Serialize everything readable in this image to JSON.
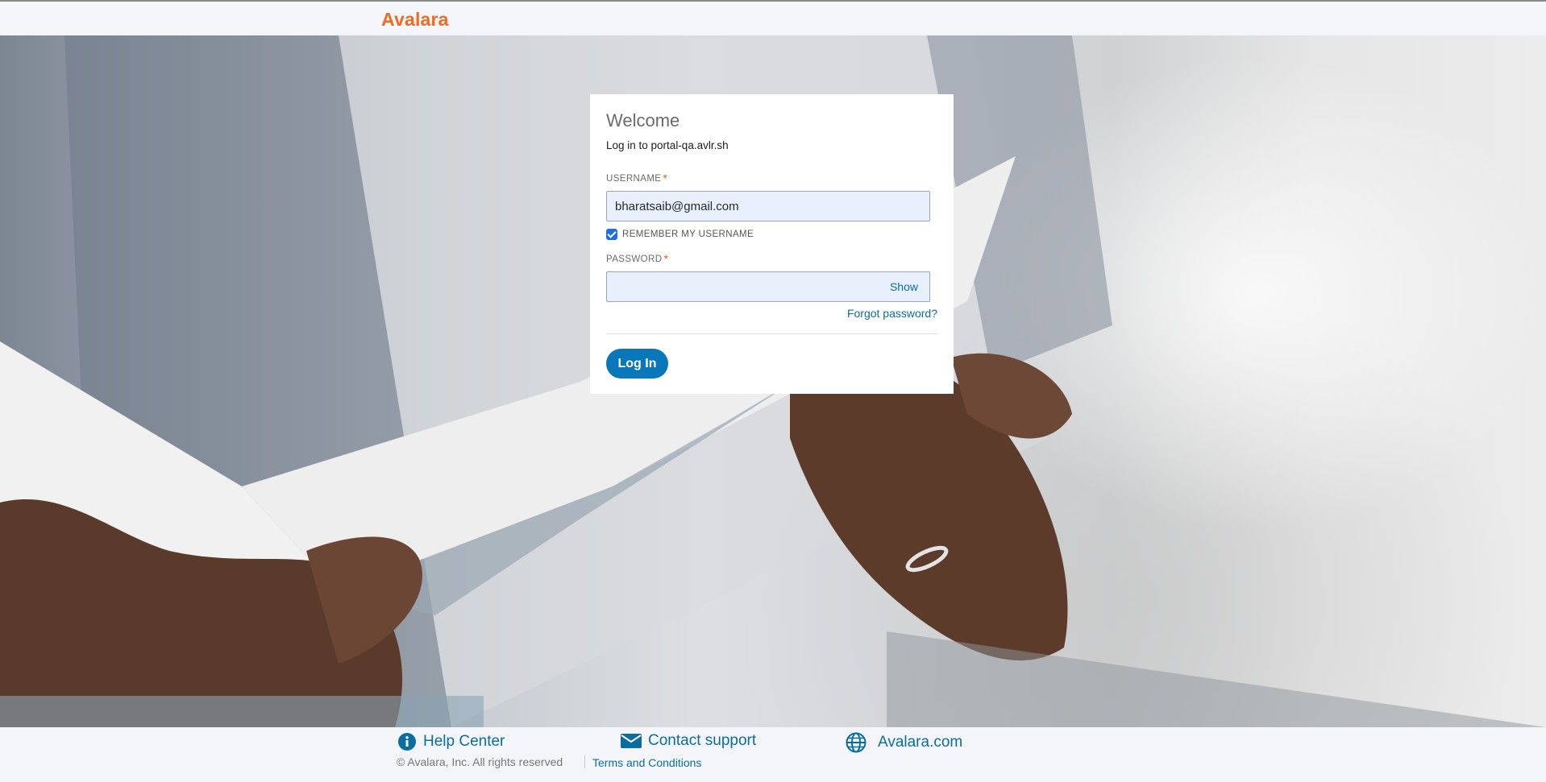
{
  "brand": {
    "name": "Avalara",
    "color": "#f26a21"
  },
  "card": {
    "title": "Welcome",
    "subtitle": "Log in to portal-qa.avlr.sh",
    "username_label": "USERNAME",
    "username_value": "bharatsaib@gmail.com",
    "required_marker": "*",
    "remember_label": "REMEMBER MY USERNAME",
    "remember_checked": true,
    "password_label": "PASSWORD",
    "password_value": "",
    "show_label": "Show",
    "forgot_label": "Forgot password?",
    "login_label": "Log In"
  },
  "footer": {
    "help_center": "Help Center",
    "contact_support": "Contact support",
    "avalara_site": "Avalara.com",
    "copyright": "© Avalara, Inc. All rights reserved",
    "terms": "Terms and Conditions",
    "icons": [
      "info-icon",
      "envelope-icon",
      "globe-icon"
    ]
  },
  "colors": {
    "accent": "#0a77b8",
    "link": "#0a6d9f",
    "field_bg": "#e8effd"
  }
}
